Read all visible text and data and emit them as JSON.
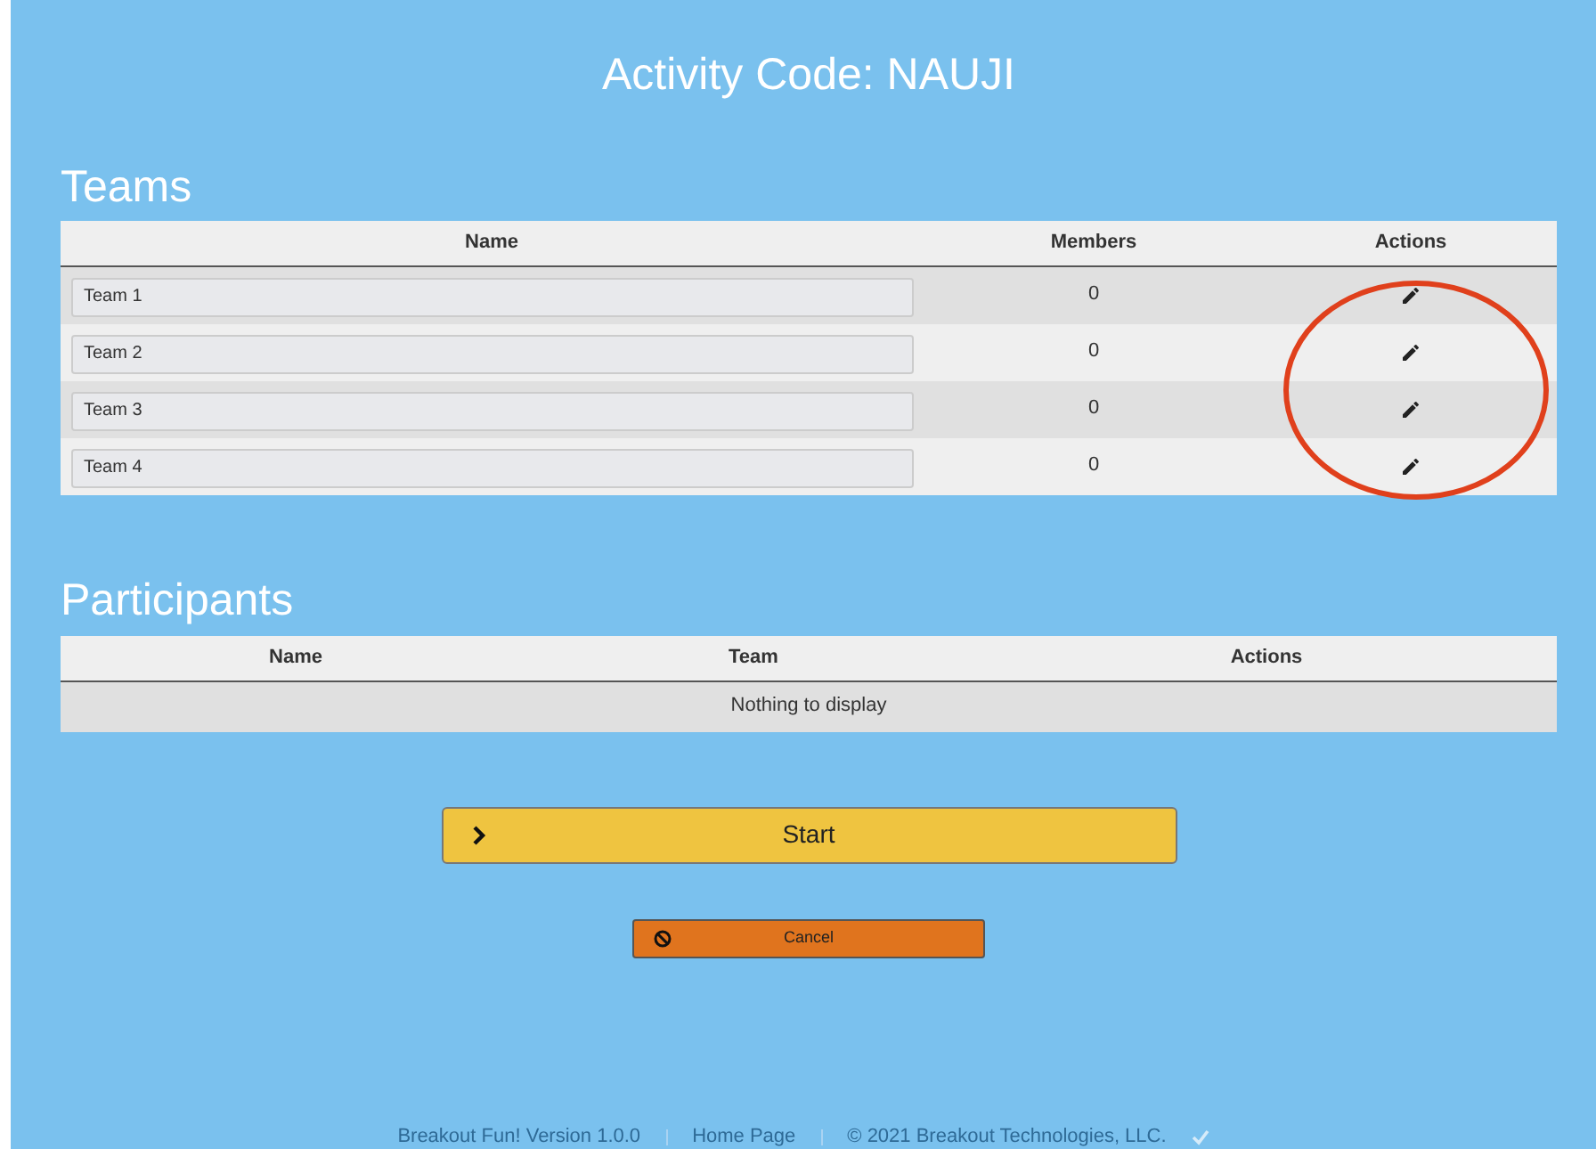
{
  "title": "Activity Code: NAUJI",
  "teams": {
    "heading": "Teams",
    "columns": [
      "Name",
      "Members",
      "Actions"
    ],
    "rows": [
      {
        "name": "Team 1",
        "members": "0"
      },
      {
        "name": "Team 2",
        "members": "0"
      },
      {
        "name": "Team 3",
        "members": "0"
      },
      {
        "name": "Team 4",
        "members": "0"
      }
    ]
  },
  "participants": {
    "heading": "Participants",
    "columns": [
      "Name",
      "Team",
      "Actions"
    ],
    "empty_message": "Nothing to display"
  },
  "buttons": [
    {
      "kind": "start",
      "label": "Start"
    },
    {
      "kind": "cancel",
      "label": "Cancel"
    }
  ],
  "footer": [
    "Breakout Fun! Version 1.0.0",
    "Home Page",
    "© 2021 Breakout Technologies, LLC."
  ]
}
